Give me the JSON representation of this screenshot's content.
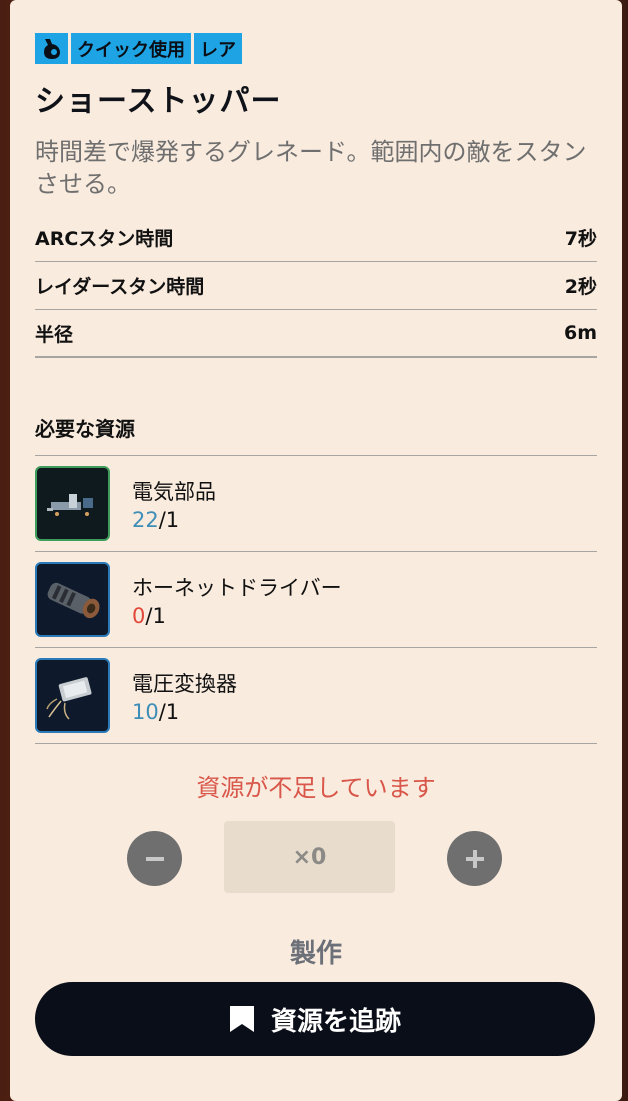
{
  "tags": {
    "type": "クイック使用",
    "rarity": "レア"
  },
  "item": {
    "name": "ショーストッパー",
    "description": "時間差で爆発するグレネード。範囲内の敵をスタンさせる。"
  },
  "stats": [
    {
      "label": "ARCスタン時間",
      "value": "7秒"
    },
    {
      "label": "レイダースタン時間",
      "value": "2秒"
    },
    {
      "label": "半径",
      "value": "6m"
    }
  ],
  "resources": {
    "title": "必要な資源",
    "items": [
      {
        "name": "電気部品",
        "have": "22",
        "need": "/1",
        "icon": "electrical-parts-icon"
      },
      {
        "name": "ホーネットドライバー",
        "have": "0",
        "need": "/1",
        "icon": "hornet-driver-icon"
      },
      {
        "name": "電圧変換器",
        "have": "10",
        "need": "/1",
        "icon": "voltage-converter-icon"
      }
    ]
  },
  "warning": "資源が不足しています",
  "quantity": {
    "value": "×0",
    "minus_icon": "minus-icon",
    "plus_icon": "plus-icon"
  },
  "craft_label": "製作",
  "track_label": "資源を追跡",
  "colors": {
    "tag": "#1ea4e4",
    "ok": "#3e8eb8",
    "bad": "#e0483a",
    "panel": "#f9ebde"
  }
}
